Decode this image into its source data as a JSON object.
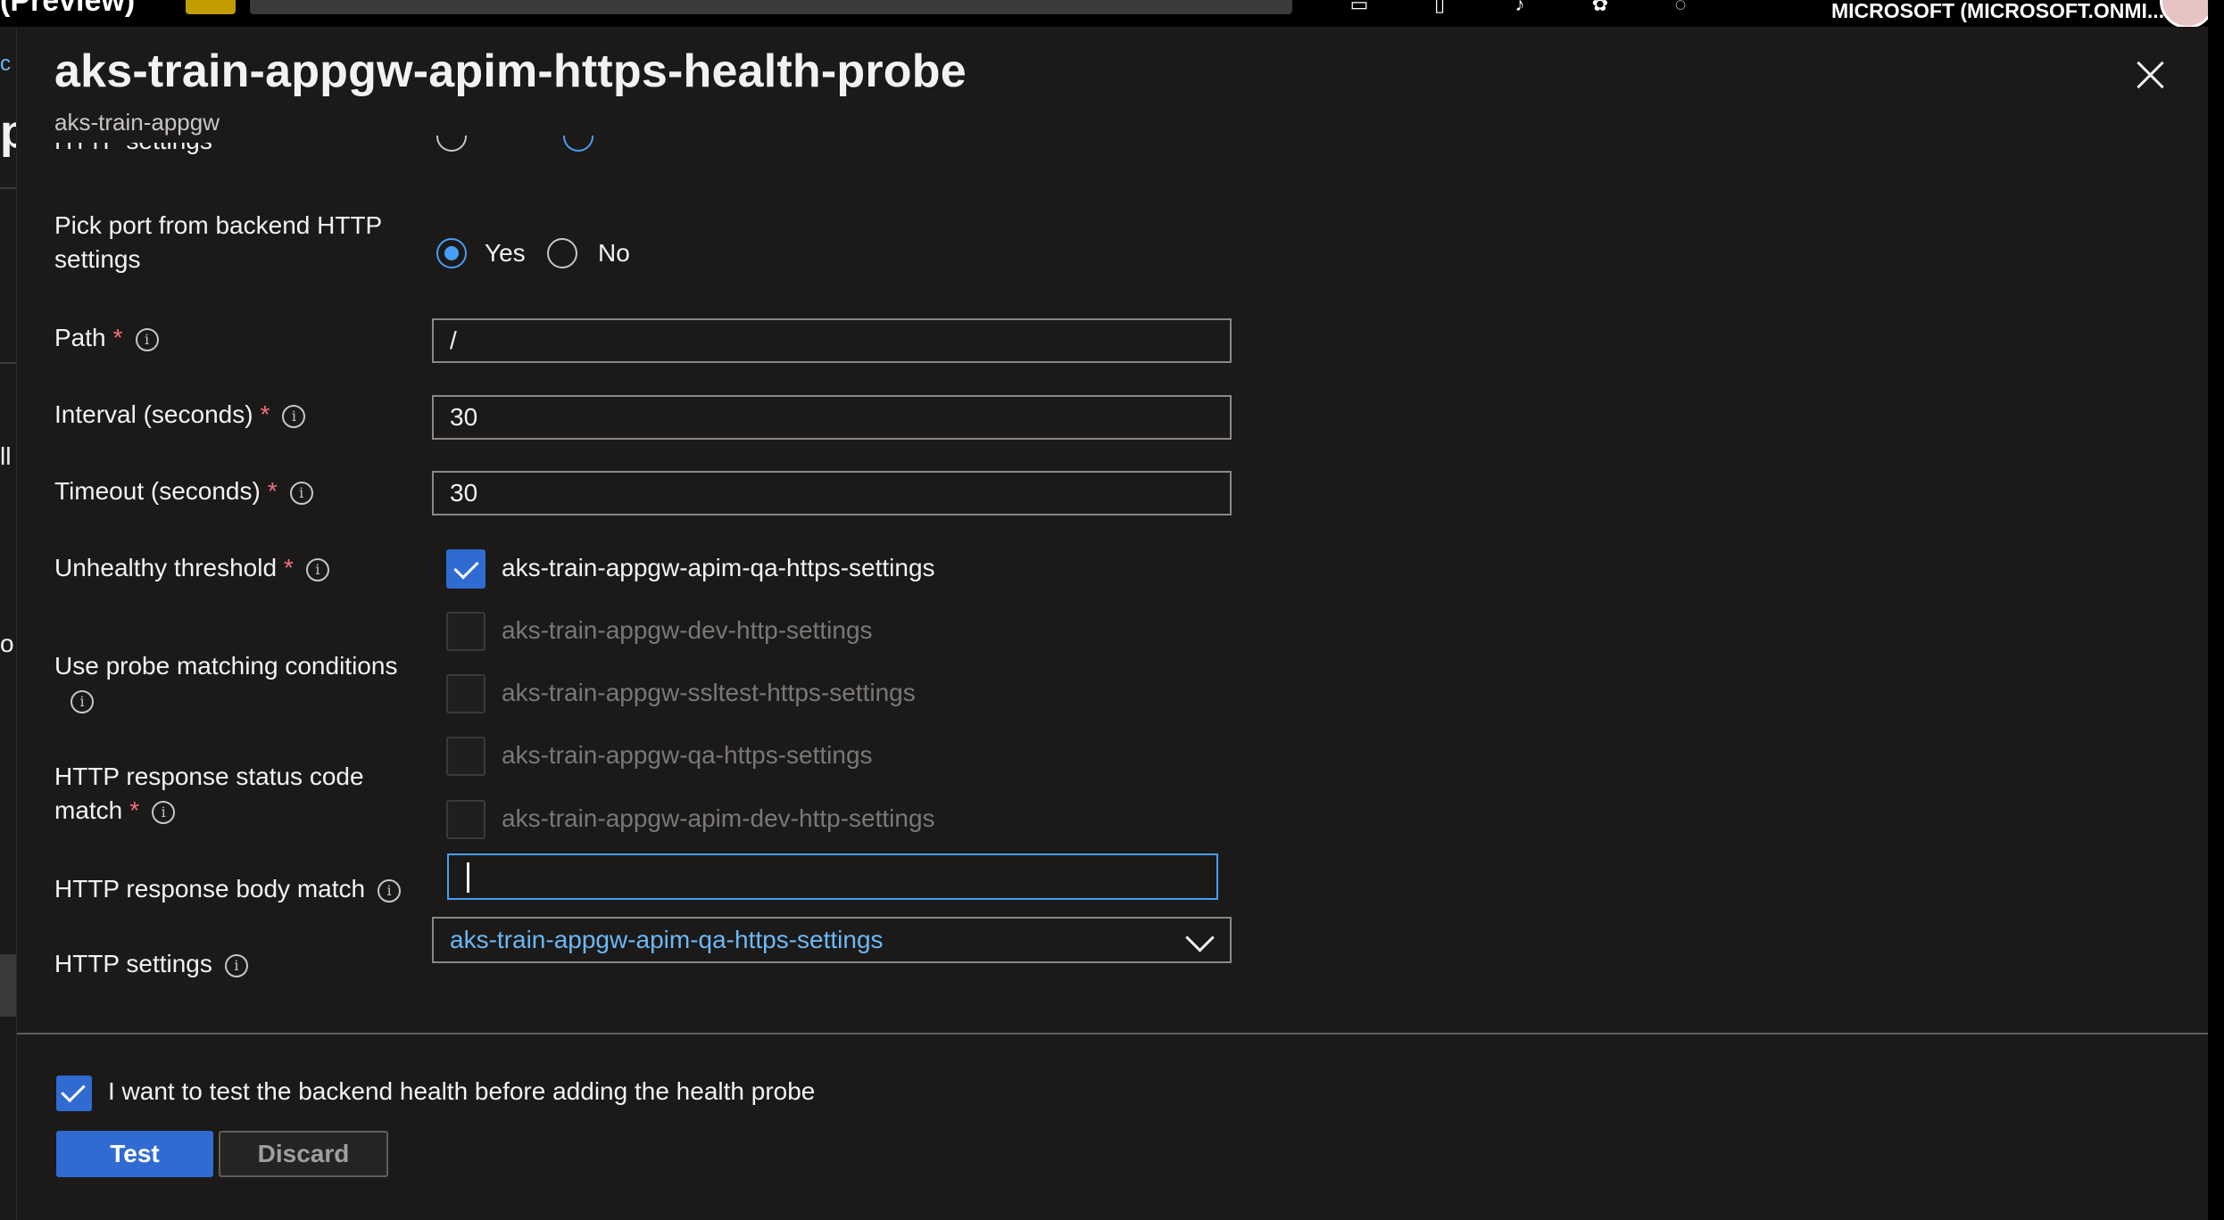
{
  "topbar": {
    "title_partial": "(Preview)",
    "tenant": "MICROSOFT (MICROSOFT.ONMI..."
  },
  "background_page": {
    "link_fragment": "c",
    "heading_fragment": "p",
    "text_fragment_1": "ll",
    "text_fragment_2": "o"
  },
  "panel": {
    "title": "aks-train-appgw-apim-https-health-probe",
    "subtitle": "aks-train-appgw",
    "close_label": "Close"
  },
  "form": {
    "cut_label": "HTTP settings",
    "pick_port_label": "Pick port from backend HTTP settings",
    "pick_port_options": [
      "Yes",
      "No"
    ],
    "pick_port_selected": "Yes",
    "path_label": "Path",
    "path_value": "/",
    "interval_label": "Interval (seconds)",
    "interval_value": "30",
    "timeout_label": "Timeout (seconds)",
    "timeout_value": "30",
    "unhealthy_label": "Unhealthy threshold",
    "probe_match_label": "Use probe matching conditions",
    "status_code_label": "HTTP response status code match",
    "body_match_label": "HTTP response body match",
    "http_settings_label": "HTTP settings",
    "http_settings_value": "aks-train-appgw-apim-qa-https-settings",
    "required_marker": "*",
    "info_glyph": "i"
  },
  "dropdown": {
    "filter_value": "",
    "options": [
      {
        "label": "aks-train-appgw-apim-qa-https-settings",
        "checked": true
      },
      {
        "label": "aks-train-appgw-dev-http-settings",
        "checked": false
      },
      {
        "label": "aks-train-appgw-ssltest-https-settings",
        "checked": false
      },
      {
        "label": "aks-train-appgw-qa-https-settings",
        "checked": false
      },
      {
        "label": "aks-train-appgw-apim-dev-http-settings",
        "checked": false
      }
    ]
  },
  "footer": {
    "test_checkbox_label": "I want to test the backend health before adding the health probe",
    "test_checkbox_checked": true,
    "test_button": "Test",
    "discard_button": "Discard"
  },
  "colors": {
    "accent": "#2f6bd1",
    "link": "#6cb8f6",
    "required": "#f1707b",
    "background": "#1b1a19"
  }
}
